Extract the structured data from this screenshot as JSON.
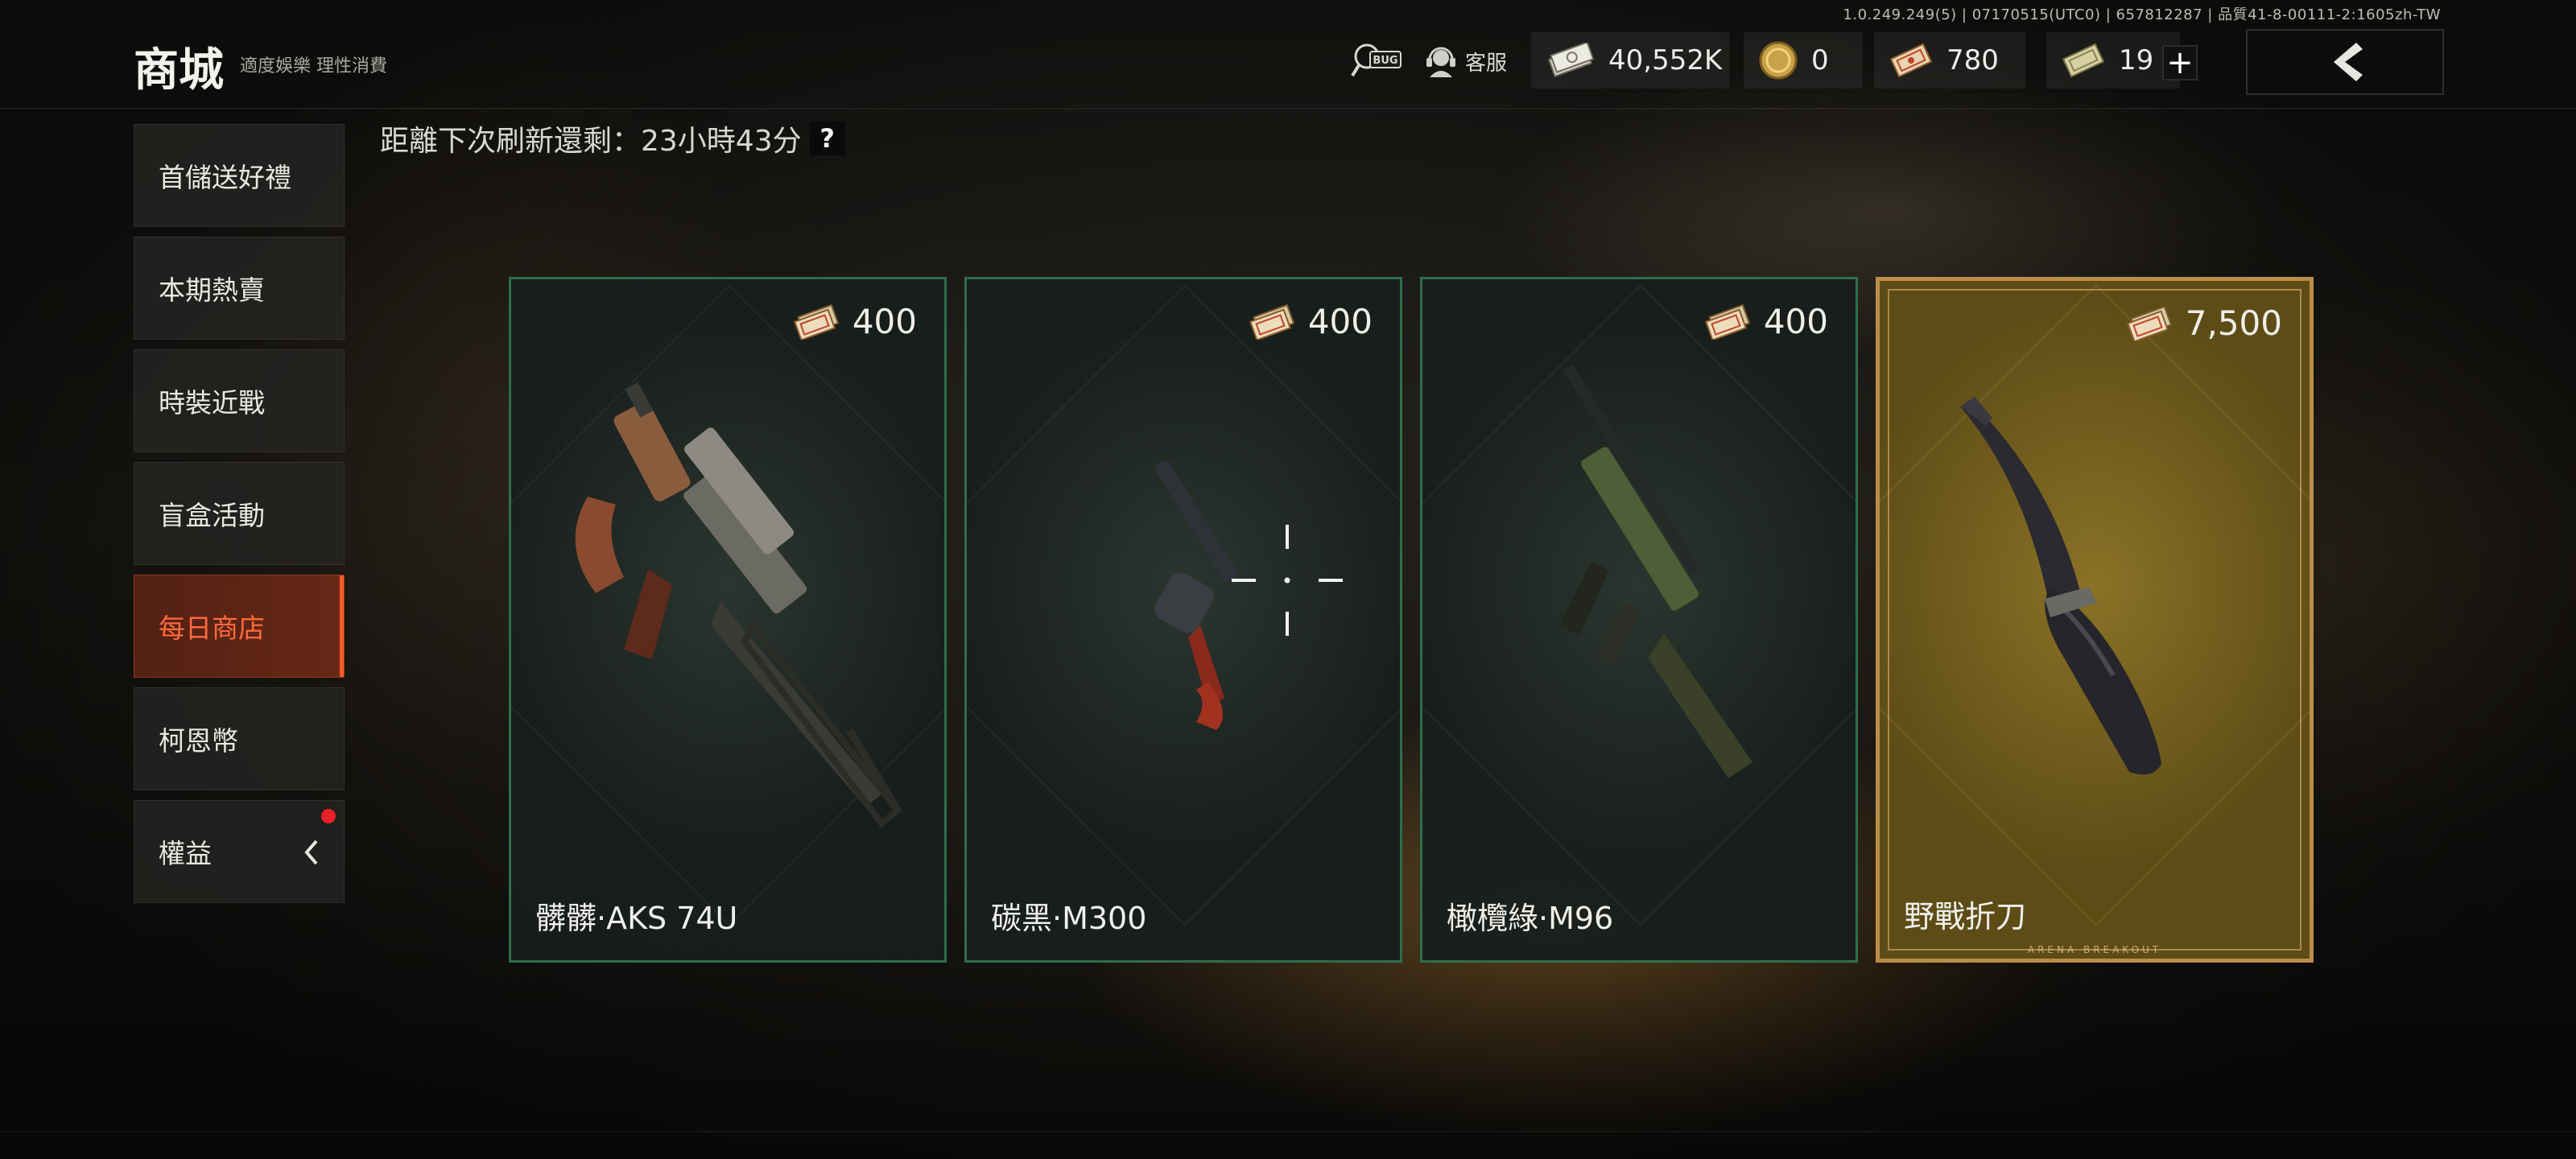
{
  "version_info": "1.0.249.249(5) | 07170515(UTC0) | 657812287 | 品質41-8-00111-2:1605zh-TW",
  "header": {
    "title": "商城",
    "subtitle": "適度娛樂 理性消費",
    "service_label": "客服",
    "bug_label": "BUG",
    "currencies": [
      {
        "icon": "cash-stack-icon",
        "value": "40,552K"
      },
      {
        "icon": "gold-coin-icon",
        "value": "0"
      },
      {
        "icon": "voucher-ticket-icon",
        "value": "780"
      },
      {
        "icon": "bond-icon",
        "value": "19"
      }
    ],
    "plus_label": "+"
  },
  "sidebar": {
    "items": [
      {
        "label": "首儲送好禮"
      },
      {
        "label": "本期熱賣"
      },
      {
        "label": "時裝近戰"
      },
      {
        "label": "盲盒活動"
      },
      {
        "label": "每日商店",
        "active": true
      },
      {
        "label": "柯恩幣"
      },
      {
        "label": "權益",
        "has_notification": true
      }
    ]
  },
  "refresh": {
    "text": "距離下次刷新還剩：23小時43分",
    "help": "?"
  },
  "cards": [
    {
      "name": "髒髒·AKS 74U",
      "price": "400",
      "price_icon": "voucher-ticket-icon",
      "item_icon": "aks74u-rifle-icon",
      "rarity": "green"
    },
    {
      "name": "碳黑·M300",
      "price": "400",
      "price_icon": "voucher-ticket-icon",
      "item_icon": "m300-revolver-icon",
      "rarity": "green"
    },
    {
      "name": "橄欖綠·M96",
      "price": "400",
      "price_icon": "voucher-ticket-icon",
      "item_icon": "m96-rifle-icon",
      "rarity": "green"
    },
    {
      "name": "野戰折刀",
      "price": "7,500",
      "price_icon": "voucher-ticket-icon",
      "item_icon": "folding-knife-icon",
      "rarity": "gold",
      "brand": "ARENA BREAKOUT"
    }
  ],
  "colors": {
    "accent_active": "#ff5a2a",
    "card_green_border": "#2f6e4b",
    "card_gold_border": "#b98d4a",
    "notification": "#e8202a"
  }
}
